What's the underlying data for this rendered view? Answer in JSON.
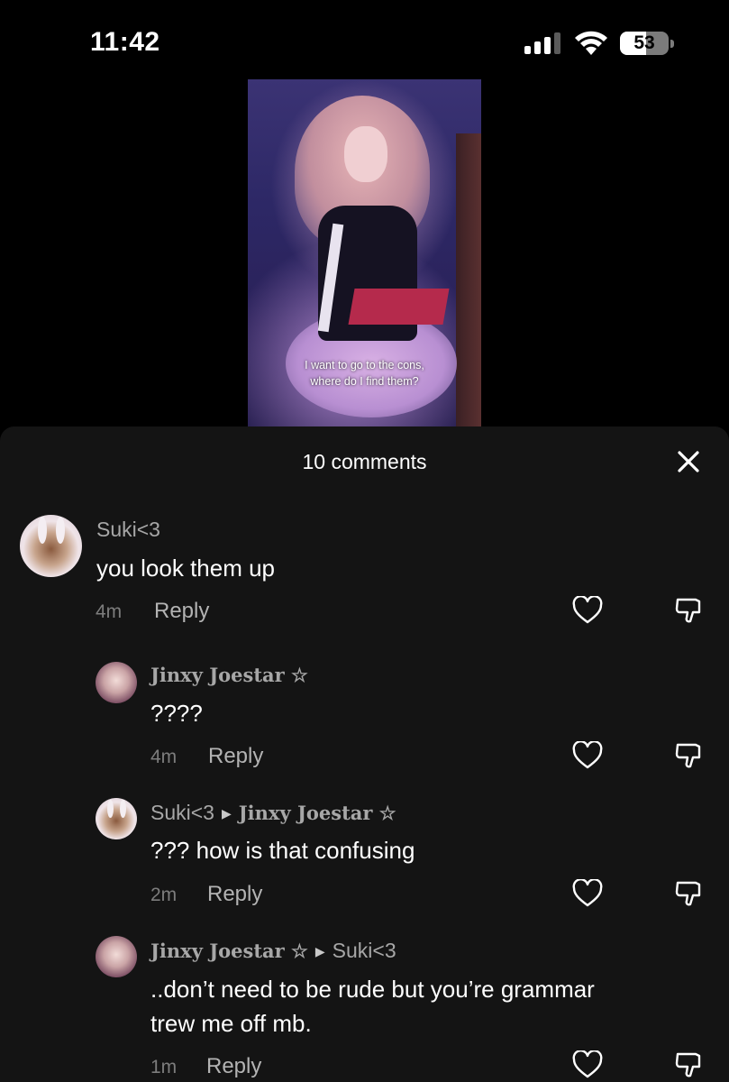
{
  "status": {
    "time": "11:42",
    "battery": "53",
    "battery_level": 0.53
  },
  "video": {
    "caption_line1": "I want to go to the cons,",
    "caption_line2": "where do I find them?"
  },
  "sheet": {
    "title": "10 comments",
    "comments": [
      {
        "user": "Suki<3",
        "text": "you look them up",
        "time": "4m",
        "reply_label": "Reply"
      },
      {
        "user": "Jinxy Joestar ☆",
        "text": "????",
        "time": "4m",
        "reply_label": "Reply"
      },
      {
        "user": "Suki<3",
        "reply_to": "Jinxy Joestar ☆",
        "text": "??? how is that confusing",
        "time": "2m",
        "reply_label": "Reply"
      },
      {
        "user": "Jinxy Joestar ☆",
        "reply_to": "Suki<3",
        "text_line1": "..don’t need to be rude but you’re grammar",
        "text_line2": "trew me off mb.",
        "time": "1m",
        "reply_label": "Reply"
      }
    ]
  },
  "icons": {
    "close": "close-icon",
    "like": "heart-icon",
    "dislike": "thumbs-down-icon",
    "arrow": "reply-arrow-icon"
  }
}
